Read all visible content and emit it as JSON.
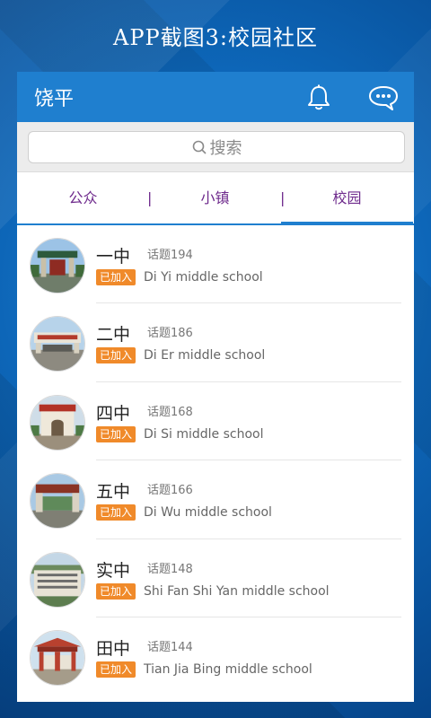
{
  "caption": "APP截图3:校园社区",
  "appbar": {
    "title": "饶平",
    "bell_icon": "bell-icon",
    "chat_icon": "chat-bubble-icon"
  },
  "search": {
    "placeholder": "搜索",
    "icon": "search-icon"
  },
  "tabs": [
    {
      "label": "公众",
      "active": false
    },
    {
      "label": "小镇",
      "active": false
    },
    {
      "label": "校园",
      "active": true
    }
  ],
  "tab_separator": "|",
  "colors": {
    "appbar": "#1f7fcf",
    "tab_text": "#6e2a8c",
    "badge": "#f08a2a",
    "background": "#0b5fae"
  },
  "schools": [
    {
      "name": "一中",
      "topics": "话题194",
      "badge": "已加入",
      "english": "Di Yi middle school",
      "photo": "school-gate-photo"
    },
    {
      "name": "二中",
      "topics": "话题186",
      "badge": "已加入",
      "english": "Di Er middle school",
      "photo": "school-entrance-photo"
    },
    {
      "name": "四中",
      "topics": "话题168",
      "badge": "已加入",
      "english": "Di Si middle school",
      "photo": "school-archway-photo"
    },
    {
      "name": "五中",
      "topics": "话题166",
      "badge": "已加入",
      "english": "Di Wu middle school",
      "photo": "school-campus-photo"
    },
    {
      "name": "实中",
      "topics": "话题148",
      "badge": "已加入",
      "english": "Shi Fan Shi Yan middle school",
      "photo": "school-building-photo"
    },
    {
      "name": "田中",
      "topics": "话题144",
      "badge": "已加入",
      "english": "Tian Jia Bing middle school",
      "photo": "school-pavilion-photo"
    }
  ]
}
